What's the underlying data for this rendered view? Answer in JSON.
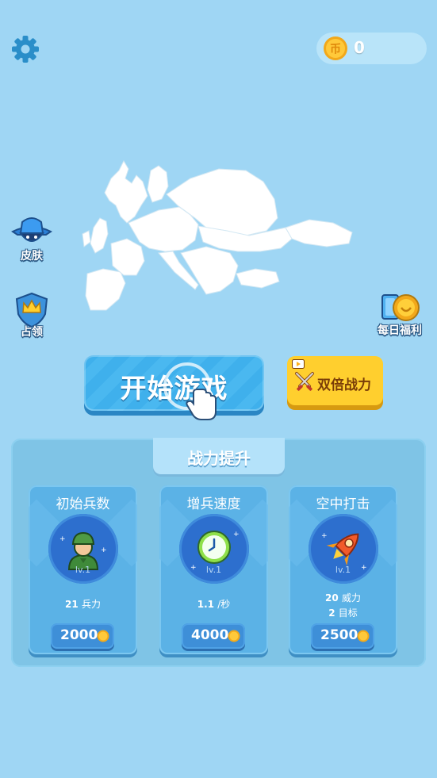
{
  "topbar": {
    "coins": "0"
  },
  "side": {
    "skin_label": "皮肤",
    "occupy_label": "占领",
    "daily_label": "每日福利"
  },
  "main": {
    "start_label": "开始游戏",
    "double_label": "双倍战力"
  },
  "panel": {
    "title": "战力提升",
    "cards": [
      {
        "title": "初始兵数",
        "level": "lv.1",
        "stat1_value": "21",
        "stat1_label": "兵力",
        "price": "2000"
      },
      {
        "title": "增兵速度",
        "level": "lv.1",
        "stat1_value": "1.1",
        "stat1_label": "/秒",
        "price": "4000"
      },
      {
        "title": "空中打击",
        "level": "lv.1",
        "stat1_value": "20",
        "stat1_label": "威力",
        "stat2_value": "2",
        "stat2_label": "目标",
        "price": "2500"
      }
    ]
  },
  "colors": {
    "background": "#9fd6f4",
    "start_button": "#3fb0ec",
    "double_button": "#ffcf2e",
    "card": "#5bb2e6",
    "coin": "#ffc21a"
  },
  "icons": {
    "settings": "gear-icon",
    "coin": "coin-icon",
    "skin": "hooded-hero-icon",
    "occupy": "crown-shield-icon",
    "daily": "gift-coin-icon",
    "video": "video-ad-icon",
    "swords": "crossed-swords-icon",
    "soldier": "soldier-icon",
    "clock": "clock-icon",
    "rocket": "rocket-icon",
    "hand": "pointing-hand-icon"
  }
}
